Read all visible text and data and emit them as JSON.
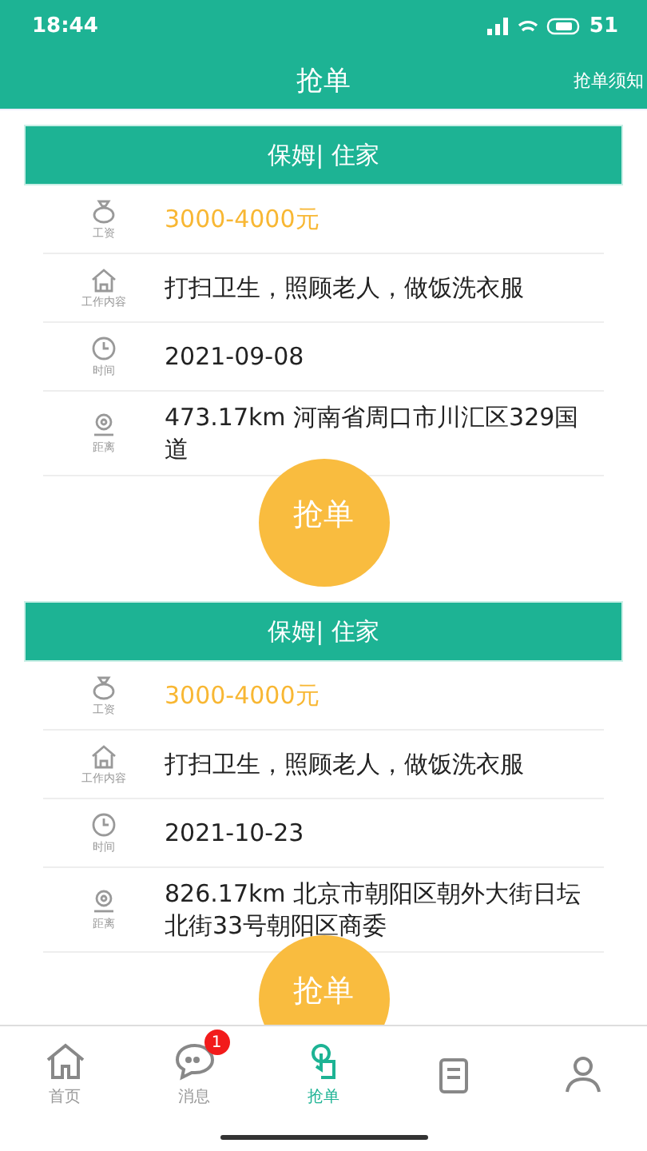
{
  "status_bar": {
    "time": "18:44",
    "battery": "51"
  },
  "header": {
    "title": "抢单",
    "action": "抢单须知"
  },
  "orders": [
    {
      "category": "保姆| 住家",
      "fields": [
        {
          "kind": "salary",
          "label": "工资",
          "value": "3000-4000元"
        },
        {
          "kind": "content",
          "label": "工作内容",
          "value": "打扫卫生，照顾老人，做饭洗衣服"
        },
        {
          "kind": "time",
          "label": "时间",
          "value": "2021-09-08"
        },
        {
          "kind": "distance",
          "label": "距离",
          "value": "473.17km 河南省周口市川汇区329国道"
        }
      ],
      "button": "抢单"
    },
    {
      "category": "保姆| 住家",
      "fields": [
        {
          "kind": "salary",
          "label": "工资",
          "value": "3000-4000元"
        },
        {
          "kind": "content",
          "label": "工作内容",
          "value": "打扫卫生，照顾老人，做饭洗衣服"
        },
        {
          "kind": "time",
          "label": "时间",
          "value": "2021-10-23"
        },
        {
          "kind": "distance",
          "label": "距离",
          "value": "826.17km 北京市朝阳区朝外大街日坛北街33号朝阳区商委"
        }
      ],
      "button": "抢单"
    }
  ],
  "tab_bar": [
    {
      "kind": "home",
      "label": "首页",
      "selected": false
    },
    {
      "kind": "message",
      "label": "消息",
      "badge": "1",
      "selected": false
    },
    {
      "kind": "grab",
      "label": "抢单",
      "selected": true
    },
    {
      "kind": "orders",
      "selected": false
    },
    {
      "kind": "profile",
      "selected": false
    }
  ]
}
